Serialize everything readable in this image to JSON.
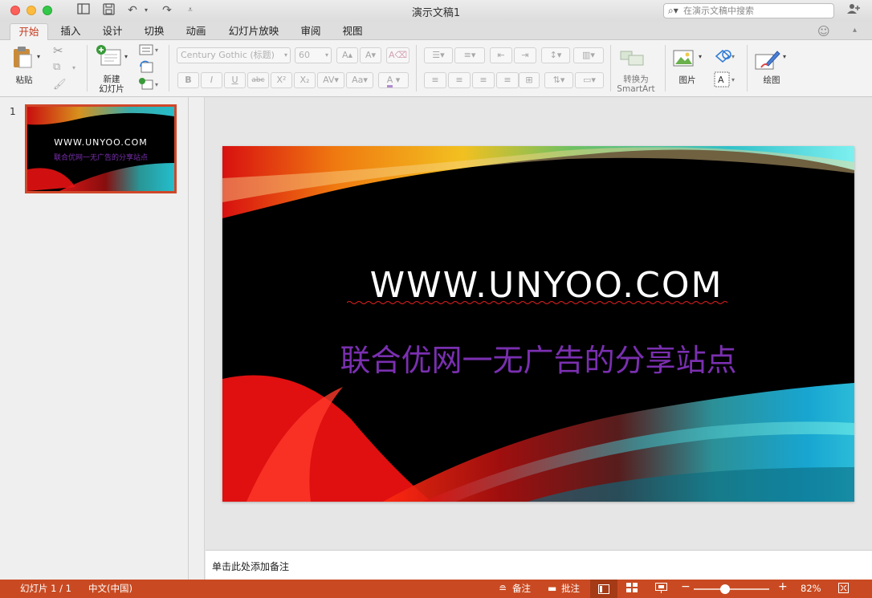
{
  "window": {
    "title": "演示文稿1"
  },
  "search": {
    "placeholder": "在演示文稿中搜索",
    "value": ""
  },
  "tabs": [
    {
      "label": "开始",
      "active": true
    },
    {
      "label": "插入"
    },
    {
      "label": "设计"
    },
    {
      "label": "切换"
    },
    {
      "label": "动画"
    },
    {
      "label": "幻灯片放映"
    },
    {
      "label": "审阅"
    },
    {
      "label": "视图"
    }
  ],
  "ribbon": {
    "paste_label": "粘贴",
    "new_slide_label_line1": "新建",
    "new_slide_label_line2": "幻灯片",
    "font_name": "Century Gothic (标题)",
    "font_size": "60",
    "bold": "B",
    "italic": "I",
    "underline": "U",
    "strike": "abc",
    "superscript": "X²",
    "subscript": "X₂",
    "convert_smartart_line1": "转换为",
    "convert_smartart_line2": "SmartArt",
    "picture_label": "图片",
    "drawing_label": "绘图"
  },
  "slides_pane": {
    "slide_number": "1",
    "thumb_title": "WWW.UNYOO.COM",
    "thumb_subtitle": "联合优网一无广告的分享站点"
  },
  "slide": {
    "title": "WWW.UNYOO.COM",
    "subtitle": "联合优网一无广告的分享站点"
  },
  "notes": {
    "placeholder": "单击此处添加备注"
  },
  "status": {
    "slide_counter": "幻灯片 1 / 1",
    "language": "中文(中国)",
    "notes_label": "备注",
    "comments_label": "批注",
    "zoom": "82%",
    "zoom_fraction": 0.42
  },
  "colors": {
    "accent": "#c94a22",
    "subtitle": "#7a2fb0",
    "active_tab": "#c4391e"
  }
}
